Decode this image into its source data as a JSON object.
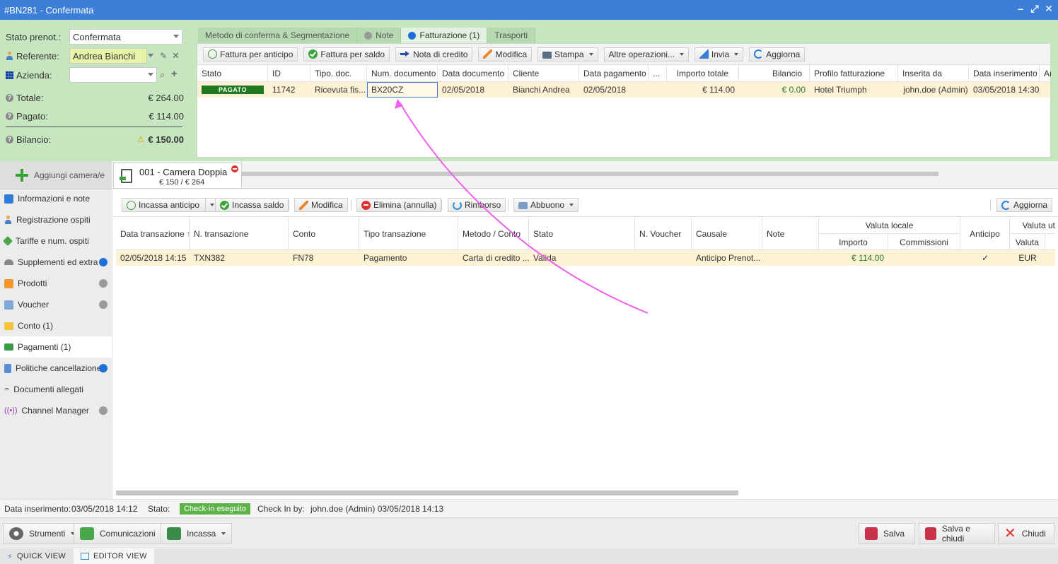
{
  "window": {
    "title": "#BN281 - Confermata"
  },
  "booking_info": {
    "stato_label": "Stato prenot.:",
    "stato_value": "Confermata",
    "referente_label": "Referente:",
    "referente_value": "Andrea Bianchi",
    "azienda_label": "Azienda:",
    "azienda_value": "",
    "totale_label": "Totale:",
    "totale_value": "€ 264.00",
    "pagato_label": "Pagato:",
    "pagato_value": "€ 114.00",
    "bilancio_label": "Bilancio:",
    "bilancio_value": "€ 150.00"
  },
  "tabs": [
    {
      "label": "Metodo di conferma & Segmentazione"
    },
    {
      "label": "Note"
    },
    {
      "label": "Fatturazione (1)"
    },
    {
      "label": "Trasporti"
    }
  ],
  "invoice_toolbar": {
    "fattura_anticipo": "Fattura per anticipo",
    "fattura_saldo": "Fattura per saldo",
    "nota_credito": "Nota di credito",
    "modifica": "Modifica",
    "stampa": "Stampa",
    "altre": "Altre operazioni...",
    "invia": "Invia",
    "aggiorna": "Aggiorna"
  },
  "invoice_grid": {
    "columns": [
      "Stato",
      "ID",
      "Tipo. doc.",
      "Num. documento",
      "Data documento",
      "Cliente",
      "Data pagamento",
      "...",
      "Importo totale",
      "Bilancio",
      "Profilo fatturazione",
      "Inserita da",
      "Data inserimento",
      "An"
    ],
    "row": {
      "stato": "PAGATO",
      "id": "11742",
      "tipo": "Ricevuta fis...",
      "num": "BX20CZ",
      "data_doc": "02/05/2018",
      "cliente": "Bianchi Andrea",
      "data_pag": "02/05/2018",
      "importo": "€ 114.00",
      "bilancio": "€ 0.00",
      "profilo": "Hotel Triumph",
      "inserita": "john.doe (Admin)",
      "data_ins": "03/05/2018 14:30"
    }
  },
  "left_nav": {
    "add_room": "Aggiungi camera/e",
    "items": [
      {
        "label": "Informazioni e note"
      },
      {
        "label": "Registrazione ospiti"
      },
      {
        "label": "Tariffe e num. ospiti"
      },
      {
        "label": "Supplementi ed extra"
      },
      {
        "label": "Prodotti"
      },
      {
        "label": "Voucher"
      },
      {
        "label": "Conto (1)"
      },
      {
        "label": "Pagamenti (1)"
      },
      {
        "label": "Politiche cancellazione"
      },
      {
        "label": "Documenti allegati"
      },
      {
        "label": "Channel Manager"
      }
    ]
  },
  "room_tab": {
    "title": "001 - Camera Doppia",
    "amount": "€ 150 / € 264"
  },
  "payments_toolbar": {
    "incassa_anticipo": "Incassa anticipo",
    "incassa_saldo": "Incassa saldo",
    "modifica": "Modifica",
    "elimina": "Elimina (annulla)",
    "rimborso": "Rimborso",
    "abbuono": "Abbuono",
    "aggiorna": "Aggiorna"
  },
  "payments_grid": {
    "columns": {
      "data": "Data transazione",
      "ntrans": "N. transazione",
      "conto": "Conto",
      "tipo": "Tipo transazione",
      "metodo": "Metodo / Conto",
      "stato": "Stato",
      "voucher": "N. Voucher",
      "causale": "Causale",
      "note": "Note",
      "valuta_locale": "Valuta locale",
      "importo": "Importo",
      "commissioni": "Commissioni",
      "anticipo": "Anticipo",
      "valuta_ut": "Valuta ut",
      "valuta": "Valuta"
    },
    "row": {
      "data": "02/05/2018 14:15",
      "ntrans": "TXN382",
      "conto": "FN78",
      "tipo": "Pagamento",
      "metodo": "Carta di credito ...",
      "stato": "Valida",
      "causale": "Anticipo Prenot...",
      "importo": "€ 114.00",
      "anticipo": "✓",
      "valuta": "EUR"
    }
  },
  "status_line": {
    "data_ins_label": "Data inserimento:",
    "data_ins_value": "03/05/2018 14:12",
    "stato_label": "Stato:",
    "stato_value": "Check-in eseguito",
    "checkin_label": "Check In by:",
    "checkin_value": "john.doe (Admin) 03/05/2018 14:13"
  },
  "bottom_bar": {
    "strumenti": "Strumenti",
    "comunicazioni": "Comunicazioni",
    "incassa": "Incassa",
    "salva": "Salva",
    "salva_chiudi": "Salva e chiudi",
    "chiudi": "Chiudi"
  },
  "view_tabs": {
    "quick": "QUICK VIEW",
    "editor": "EDITOR VIEW"
  },
  "colors": {
    "titlebar": "#3c7fd8",
    "top_zone": "#c6e6c0",
    "highlight_row": "#fdf2d4",
    "paid_badge": "#1f7a1f",
    "annotation_arrow": "#f55cf0"
  }
}
